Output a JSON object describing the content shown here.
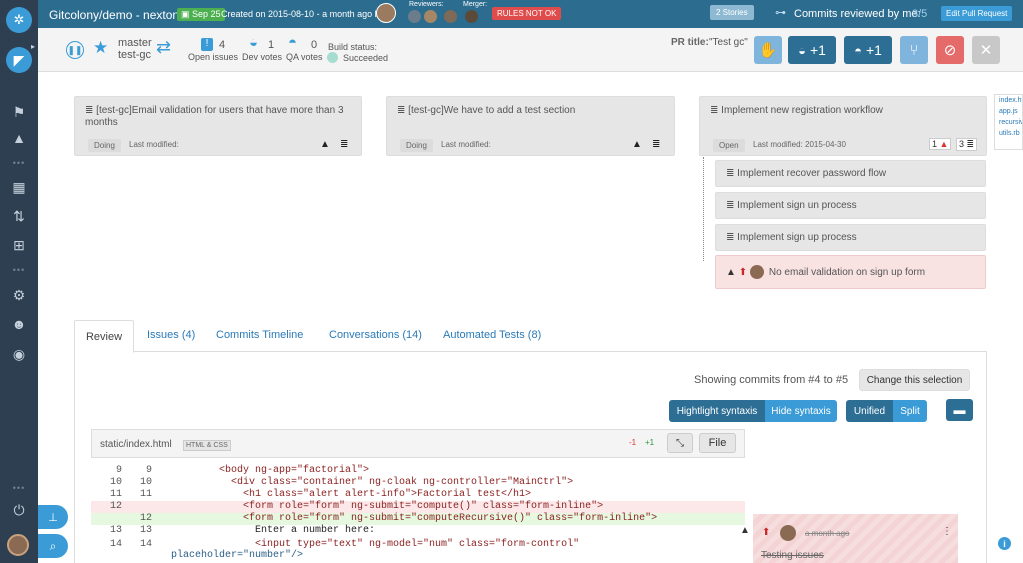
{
  "topbar": {
    "repo": "Gitcolony/demo - nexton",
    "date_badge": "Sep 25",
    "created": "Created on 2015-08-10 - a month ago by",
    "reviewers_label": "Reviewers:",
    "merger_label": "Merger:",
    "rules_badge": "RULES NOT OK",
    "stories_btn": "2 Stories",
    "commits_label": "Commits reviewed by me:",
    "commits_count": "3/5",
    "edit_btn": "Edit Pull Request"
  },
  "branch": {
    "from": "master",
    "to": "test-gc"
  },
  "stats": {
    "open_issues": "4",
    "open_issues_label": "Open issues",
    "dev_votes": "1",
    "dev_votes_label": "Dev votes",
    "qa_votes": "0",
    "qa_votes_label": "QA votes",
    "build_label": "Build status:",
    "build_value": "Succeeded"
  },
  "pr": {
    "title_label": "PR title:",
    "title_value": "\"Test gc\""
  },
  "toolbar": {
    "dev_plus": "+1",
    "qa_plus": "+1"
  },
  "cards": [
    {
      "title": "[test-gc]Email validation for users that have more than 3 months",
      "status": "Doing",
      "modified": "Last modified:"
    },
    {
      "title": "[test-gc]We have to add a test section",
      "status": "Doing",
      "modified": "Last modified:"
    },
    {
      "title": "Implement new registration workflow",
      "status": "Open",
      "modified": "Last modified: 2015-04-30",
      "warn_count": "1",
      "list_count": "3"
    }
  ],
  "subtasks": [
    "Implement recover password flow",
    "Implement sign un process",
    "Implement sign up process"
  ],
  "issue_card": "No email validation on sign up form",
  "files": [
    "index.ht",
    "app.js",
    "recursiv",
    "utils.rb"
  ],
  "tabs": [
    "Review",
    "Issues (4)",
    "Commits Timeline",
    "Conversations (14)",
    "Automated Tests (8)"
  ],
  "review": {
    "showing": "Showing commits from #4 to #5",
    "change_btn": "Change this selection",
    "highlight_btn": "Hightlight syntaxis",
    "hide_btn": "Hide syntaxis",
    "unified_btn": "Unified",
    "split_btn": "Split"
  },
  "file": {
    "name": "static/index.html",
    "lang": "HTML & CSS",
    "minus": "-1",
    "plus": "+1",
    "file_btn": "File"
  },
  "code_lines": [
    {
      "o": "9",
      "n": "9",
      "t": "        <body ng-app=\"factorial\">"
    },
    {
      "o": "10",
      "n": "10",
      "t": "          <div class=\"container\" ng-cloak ng-controller=\"MainCtrl\">"
    },
    {
      "o": "11",
      "n": "11",
      "t": "            <h1 class=\"alert alert-info\">Factorial test</h1>"
    },
    {
      "o": "12",
      "n": "",
      "t": "            <form role=\"form\" ng-submit=\"compute()\" class=\"form-inline\">"
    },
    {
      "o": "",
      "n": "12",
      "t": "            <form role=\"form\" ng-submit=\"computeRecursive()\" class=\"form-inline\">"
    },
    {
      "o": "13",
      "n": "13",
      "t": "              Enter a number here:"
    },
    {
      "o": "14",
      "n": "14",
      "t": "              <input type=\"text\" ng-model=\"num\" class=\"form-control\""
    },
    {
      "o": "",
      "n": "",
      "t": "placeholder=\"number\"/>"
    }
  ],
  "comment": {
    "time": "a month ago",
    "text": "Testing issues"
  }
}
